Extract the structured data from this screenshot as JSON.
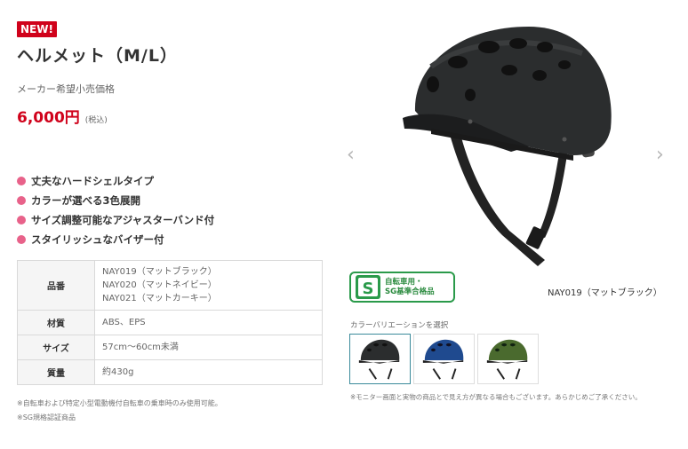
{
  "product": {
    "badge": "NEW!",
    "title": "ヘルメット（M/L）",
    "price_label": "メーカー希望小売価格",
    "price": "6,000円",
    "tax_note": "(税込)"
  },
  "features": [
    "丈夫なハードシェルタイプ",
    "カラーが選べる3色展開",
    "サイズ調整可能なアジャスターバンド付",
    "スタイリッシュなバイザー付"
  ],
  "spec": {
    "rows": [
      {
        "label": "品番",
        "values": [
          "NAY019（マットブラック）",
          "NAY020（マットネイビー）",
          "NAY021（マットカーキー）"
        ]
      },
      {
        "label": "材質",
        "values": [
          "ABS、EPS"
        ]
      },
      {
        "label": "サイズ",
        "values": [
          "57cm〜60cm未満"
        ]
      },
      {
        "label": "質量",
        "values": [
          "約430g"
        ]
      }
    ]
  },
  "notes": {
    "note1": "※自転車および特定小型電動機付自転車の乗車時のみ使用可能。",
    "note2": "※SG規格認証商品"
  },
  "gallery": {
    "prev_arrow": "‹",
    "next_arrow": "›",
    "caption": "NAY019（マットブラック）",
    "sg_logo_letter": "S",
    "sg_line1": "自転車用・",
    "sg_line2": "SG基準合格品",
    "variation_label": "カラーバリエーションを選択",
    "variation_note": "※モニター画面と実物の商品とで見え方が異なる場合もございます。あらかじめご了承ください。",
    "variants": [
      {
        "color": "#2b2d2e",
        "selected": true
      },
      {
        "color": "#1f4a8f",
        "selected": false
      },
      {
        "color": "#4a6a2e",
        "selected": false
      }
    ]
  },
  "colors": {
    "accent_red": "#d0021b",
    "bullet_pink": "#e8628a",
    "sg_green": "#2a9a4a",
    "helmet_black": "#2b2d2e"
  }
}
